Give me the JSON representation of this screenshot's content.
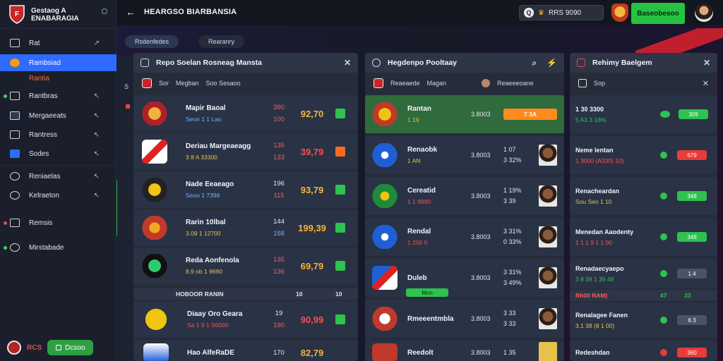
{
  "app": {
    "brand": "Gestaog A ENABARAGIA",
    "title": "HEARGSO BIARBANSIA"
  },
  "sidebar": {
    "items": [
      {
        "label": "Rat",
        "arrow": "↗"
      },
      {
        "label": "Rambsiad",
        "active": true
      },
      {
        "label": "Rantia"
      },
      {
        "label": "Rantbras",
        "arrow": "↖"
      },
      {
        "label": "Mergaeeats",
        "arrow": "↖"
      },
      {
        "label": "Rantress",
        "arrow": "↖"
      },
      {
        "label": "Sodes",
        "arrow": "↖"
      },
      {
        "label": "Reniaelas",
        "arrow": "↖"
      },
      {
        "label": "Kelraeton",
        "arrow": "↖"
      },
      {
        "label": "Remsis"
      },
      {
        "label": "Mirstabade"
      }
    ],
    "bottom_badge": "RCS",
    "bottom_button": "Dcsoo"
  },
  "top": {
    "coin_text": "RRS 9090",
    "cta": "Baseobesoo"
  },
  "chips": [
    "Rsdenfedes",
    "Rearanry"
  ],
  "panel1": {
    "title": "Repo Soelan Rosneag Mansta",
    "sub1": "Sor",
    "sub2": "Megban",
    "sub3": "Soo Sesaoo",
    "rows": [
      {
        "name": "Mapir Baoal",
        "sub": "Seon 1 1 Lao",
        "o1": "390",
        "o2": "100",
        "price": "92,70"
      },
      {
        "name": "Deriau Margeaeagg",
        "sub": "3 8 A 33300",
        "o1": "135",
        "o2": "133",
        "price": "39,79"
      },
      {
        "name": "Nade Eeaeago",
        "sub": "Seoo 1 7398",
        "o1": "196",
        "o2": "115",
        "price": "93,79"
      },
      {
        "name": "Rarin 10lbal",
        "sub": "3.09 1 12700",
        "o1": "144",
        "o2": "158",
        "price": "199,39"
      },
      {
        "name": "Reda Aonfenola",
        "sub": "8.9 ob 1 9690",
        "o1": "135",
        "o2": "136",
        "price": "69,79"
      },
      {
        "name": "Diaay Oro Geara",
        "sub": "Sa 1 9 1 S6000",
        "o1": "19",
        "o2": "190",
        "price": "90,99"
      },
      {
        "name": "Hao AlfeRaDE",
        "sub": "",
        "o1": "170",
        "o2": "",
        "price": "82,79"
      }
    ],
    "divider": "HOBOOR RANIN",
    "divider_a": "10",
    "divider_b": "10"
  },
  "panel2": {
    "title": "Hegdenpo Pooltaay",
    "sub1": "Reaeaede",
    "sub2": "Magan",
    "sub3": "Reaeeeoane",
    "rows": [
      {
        "name": "Rantan",
        "sub": "1 19",
        "v": "3.8003",
        "a": "7 3A",
        "b": ""
      },
      {
        "name": "Renaobk",
        "sub": "1 AN",
        "v": "3.8003",
        "a": "1 07",
        "b": "3 32%"
      },
      {
        "name": "Cereatid",
        "sub": "1 1 9990",
        "v": "3.8003",
        "a": "1 19%",
        "b": "3 39"
      },
      {
        "name": "Rendal",
        "sub": "1 200 0",
        "v": "3.8003",
        "a": "3 31%",
        "b": "0 33%"
      },
      {
        "name": "Duleb",
        "sub": "",
        "v": "3.8003",
        "a": "3 31%",
        "b": "3 49%"
      },
      {
        "name": "Rmeeentmbla",
        "sub": "",
        "v": "3.8003",
        "a": "3 33",
        "b": "3 33"
      },
      {
        "name": "Reedolt",
        "sub": "",
        "v": "3.8003",
        "a": "1 35",
        "b": ""
      }
    ],
    "divider_tag": "Mon"
  },
  "panel3": {
    "title": "Rehimy Baelgem",
    "sub": "Sop",
    "rows": [
      {
        "name": "1 30 3300",
        "sub": "5 A3 3 18%",
        "btn": "309",
        "top": "SS"
      },
      {
        "name": "Neme lentan",
        "sub": "1 3000 (A330) 10)",
        "btn": "679"
      },
      {
        "name": "Renacheardan",
        "sub": "Sou Seo 1 10",
        "btn": "348"
      },
      {
        "name": "Menedan Aaodenty",
        "sub": "1 1 1 9 1 1 00",
        "btn": "348"
      },
      {
        "name": "Renadaecyaepo",
        "sub": "3 8 39 1 39 49",
        "btn": "1 4"
      },
      {
        "name": "Renalagee Fanen",
        "sub": "3.1 38 (8 1 00)",
        "btn": "6 3"
      },
      {
        "name": "Redeshdan",
        "sub": "",
        "btn": "360"
      }
    ],
    "divider": "Rh00 RAM)",
    "divider_a": "47",
    "divider_b": "33"
  },
  "colors": {
    "accent": "#2f6bff",
    "green": "#2ec24e",
    "red": "#e83b3b",
    "orange": "#ff8a1e"
  }
}
